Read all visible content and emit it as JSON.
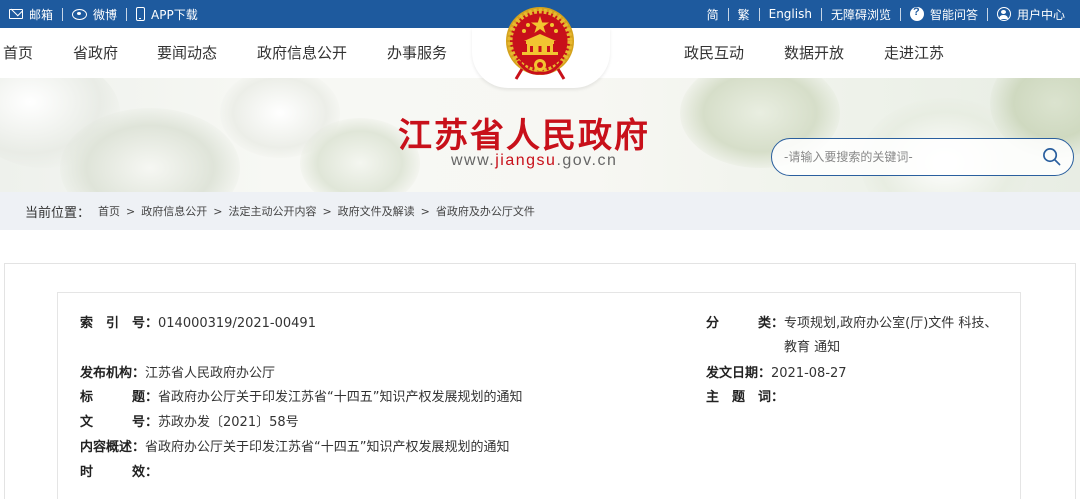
{
  "topbar": {
    "left": [
      {
        "label": "邮箱",
        "icon": "mail-icon"
      },
      {
        "label": "微博",
        "icon": "weibo-icon"
      },
      {
        "label": "APP下载",
        "icon": "phone-icon"
      }
    ],
    "right": [
      {
        "label": "简"
      },
      {
        "label": "繁"
      },
      {
        "label": "English"
      },
      {
        "label": "无障碍浏览"
      },
      {
        "label": "智能问答",
        "icon": "chat-bubble-icon"
      },
      {
        "label": "用户中心",
        "icon": "user-icon"
      }
    ]
  },
  "nav": {
    "left": [
      "首页",
      "省政府",
      "要闻动态",
      "政府信息公开",
      "办事服务"
    ],
    "right": [
      "政民互动",
      "数据开放",
      "走进江苏"
    ]
  },
  "brand": {
    "title": "江苏省人民政府",
    "url_prefix": "www.",
    "url_highlight": "jiangsu",
    "url_suffix": ".gov.cn",
    "emblem_icon": "national-emblem-icon"
  },
  "search": {
    "placeholder": "-请输入要搜索的关键词-"
  },
  "breadcrumb": {
    "label": "当前位置：",
    "items": [
      "首页",
      "政府信息公开",
      "法定主动公开内容",
      "政府文件及解读",
      "省政府及办公厅文件"
    ]
  },
  "meta": {
    "index_label": "索　引　号：",
    "index_value": "014000319/2021-00491",
    "category_label": "分　　　类：",
    "category_value_line1": "专项规划,政府办公室(厅)文件 科技、",
    "category_value_line2": "教育 通知",
    "publisher_label": "发布机构：",
    "publisher_value": "江苏省人民政府办公厅",
    "date_label": "发文日期：",
    "date_value": "2021-08-27",
    "title_label": "标　　　题：",
    "title_value": "省政府办公厅关于印发江苏省“十四五”知识产权发展规划的通知",
    "subject_label": "主　题　词：",
    "subject_value": "",
    "docno_label": "文　　　号：",
    "docno_value": "苏政办发〔2021〕58号",
    "summary_label": "内容概述：",
    "summary_value": "省政府办公厅关于印发江苏省“十四五”知识产权发展规划的通知",
    "validity_label": "时　　　效：",
    "validity_value": ""
  },
  "colors": {
    "topbar": "#1e5a9e",
    "brand_red": "#c8101a",
    "breadcrumb_bg": "#eef1f5"
  }
}
